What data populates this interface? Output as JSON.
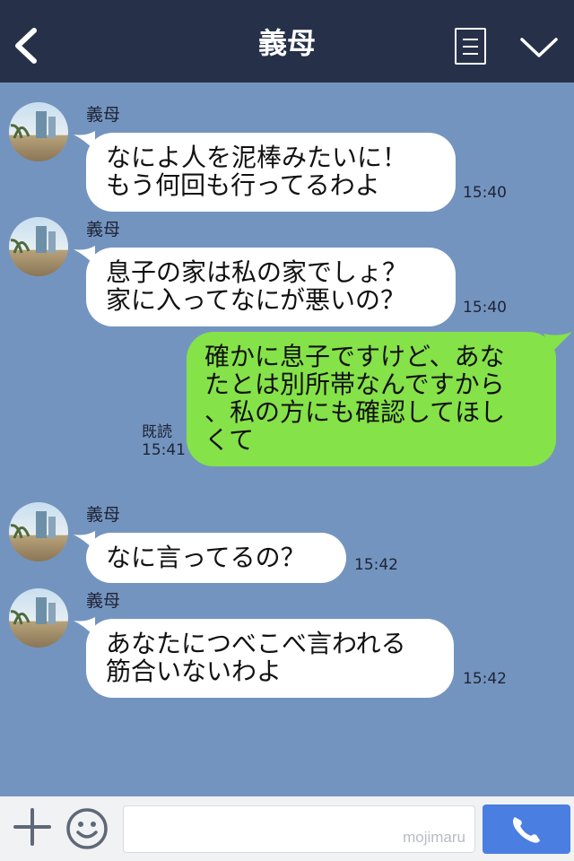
{
  "header": {
    "title": "義母",
    "back_icon": "back-chevron-icon",
    "menu_icon": "menu-list-icon",
    "dropdown_icon": "chevron-down-icon",
    "background": "#263149"
  },
  "chat": {
    "background": "#7494c0",
    "messages": [
      {
        "sender": "義母",
        "lines": [
          "なによ人を泥棒みたいに！",
          "もう何回も行ってるわよ"
        ],
        "time": "15:40",
        "direction": "incoming"
      },
      {
        "sender": "義母",
        "lines": [
          "息子の家は私の家でしょ？",
          "家に入ってなにが悪いの？"
        ],
        "time": "15:40",
        "direction": "incoming"
      },
      {
        "lines": [
          "確かに息子ですけど、あな",
          "たとは別所帯なんですから",
          "、私の方にも確認してほし",
          "くて"
        ],
        "read_label": "既読",
        "time": "15:41",
        "direction": "outgoing"
      },
      {
        "sender": "義母",
        "lines": [
          "なに言ってるの？"
        ],
        "time": "15:42",
        "direction": "incoming"
      },
      {
        "sender": "義母",
        "lines": [
          "あなたにつべこべ言われる",
          "筋合いないわよ"
        ],
        "time": "15:42",
        "direction": "incoming"
      }
    ]
  },
  "footer": {
    "plus_icon": "plus-icon",
    "emoji_icon": "smiley-icon",
    "input_value": "",
    "watermark": "mojimaru",
    "call_icon": "phone-icon",
    "call_color": "#4a7ee0"
  },
  "colors": {
    "incoming_bubble": "#ffffff",
    "outgoing_bubble": "#85e249"
  }
}
